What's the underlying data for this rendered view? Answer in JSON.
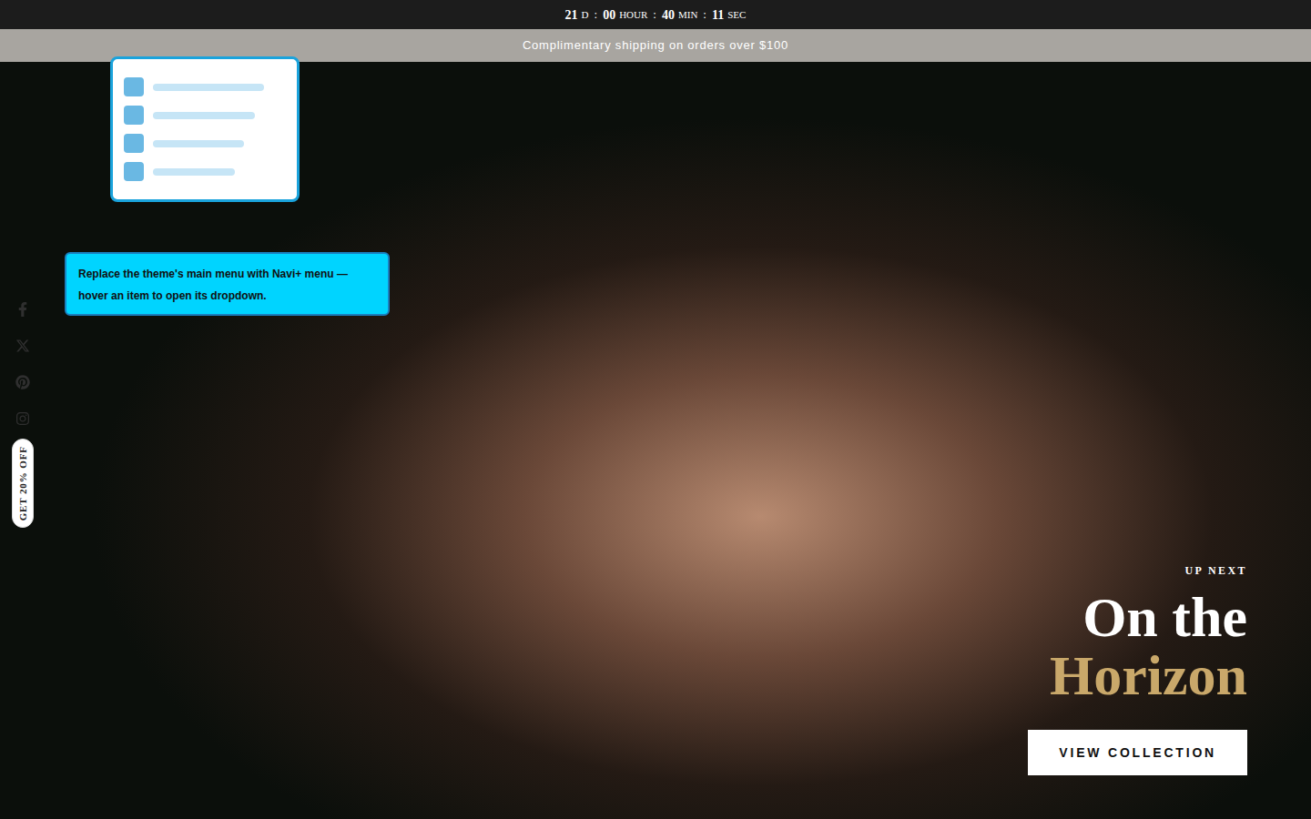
{
  "countdown": [
    {
      "value": "21",
      "unit": "D"
    },
    {
      "value": "00",
      "unit": "HOUR"
    },
    {
      "value": "40",
      "unit": "MIN"
    },
    {
      "value": "11",
      "unit": "SEC"
    }
  ],
  "countdown_separator": ":",
  "announcement": "Complimentary shipping on orders over $100",
  "tooltip": "Replace the theme's main menu with Navi+ menu — hover an item to open its dropdown.",
  "discount_tab": "GET 20% OFF",
  "hero": {
    "eyebrow": "UP NEXT",
    "title_line1": "On the",
    "title_line2": "Horizon",
    "button": "VIEW COLLECTION"
  }
}
